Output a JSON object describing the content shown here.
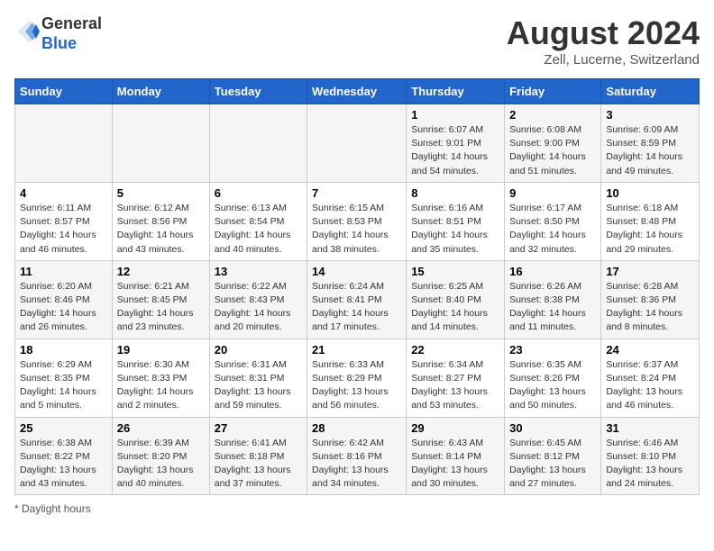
{
  "header": {
    "logo_line1": "General",
    "logo_line2": "Blue",
    "month_year": "August 2024",
    "location": "Zell, Lucerne, Switzerland"
  },
  "footer": {
    "note": "Daylight hours"
  },
  "days_of_week": [
    "Sunday",
    "Monday",
    "Tuesday",
    "Wednesday",
    "Thursday",
    "Friday",
    "Saturday"
  ],
  "weeks": [
    [
      {
        "day": "",
        "info": ""
      },
      {
        "day": "",
        "info": ""
      },
      {
        "day": "",
        "info": ""
      },
      {
        "day": "",
        "info": ""
      },
      {
        "day": "1",
        "info": "Sunrise: 6:07 AM\nSunset: 9:01 PM\nDaylight: 14 hours\nand 54 minutes."
      },
      {
        "day": "2",
        "info": "Sunrise: 6:08 AM\nSunset: 9:00 PM\nDaylight: 14 hours\nand 51 minutes."
      },
      {
        "day": "3",
        "info": "Sunrise: 6:09 AM\nSunset: 8:59 PM\nDaylight: 14 hours\nand 49 minutes."
      }
    ],
    [
      {
        "day": "4",
        "info": "Sunrise: 6:11 AM\nSunset: 8:57 PM\nDaylight: 14 hours\nand 46 minutes."
      },
      {
        "day": "5",
        "info": "Sunrise: 6:12 AM\nSunset: 8:56 PM\nDaylight: 14 hours\nand 43 minutes."
      },
      {
        "day": "6",
        "info": "Sunrise: 6:13 AM\nSunset: 8:54 PM\nDaylight: 14 hours\nand 40 minutes."
      },
      {
        "day": "7",
        "info": "Sunrise: 6:15 AM\nSunset: 8:53 PM\nDaylight: 14 hours\nand 38 minutes."
      },
      {
        "day": "8",
        "info": "Sunrise: 6:16 AM\nSunset: 8:51 PM\nDaylight: 14 hours\nand 35 minutes."
      },
      {
        "day": "9",
        "info": "Sunrise: 6:17 AM\nSunset: 8:50 PM\nDaylight: 14 hours\nand 32 minutes."
      },
      {
        "day": "10",
        "info": "Sunrise: 6:18 AM\nSunset: 8:48 PM\nDaylight: 14 hours\nand 29 minutes."
      }
    ],
    [
      {
        "day": "11",
        "info": "Sunrise: 6:20 AM\nSunset: 8:46 PM\nDaylight: 14 hours\nand 26 minutes."
      },
      {
        "day": "12",
        "info": "Sunrise: 6:21 AM\nSunset: 8:45 PM\nDaylight: 14 hours\nand 23 minutes."
      },
      {
        "day": "13",
        "info": "Sunrise: 6:22 AM\nSunset: 8:43 PM\nDaylight: 14 hours\nand 20 minutes."
      },
      {
        "day": "14",
        "info": "Sunrise: 6:24 AM\nSunset: 8:41 PM\nDaylight: 14 hours\nand 17 minutes."
      },
      {
        "day": "15",
        "info": "Sunrise: 6:25 AM\nSunset: 8:40 PM\nDaylight: 14 hours\nand 14 minutes."
      },
      {
        "day": "16",
        "info": "Sunrise: 6:26 AM\nSunset: 8:38 PM\nDaylight: 14 hours\nand 11 minutes."
      },
      {
        "day": "17",
        "info": "Sunrise: 6:28 AM\nSunset: 8:36 PM\nDaylight: 14 hours\nand 8 minutes."
      }
    ],
    [
      {
        "day": "18",
        "info": "Sunrise: 6:29 AM\nSunset: 8:35 PM\nDaylight: 14 hours\nand 5 minutes."
      },
      {
        "day": "19",
        "info": "Sunrise: 6:30 AM\nSunset: 8:33 PM\nDaylight: 14 hours\nand 2 minutes."
      },
      {
        "day": "20",
        "info": "Sunrise: 6:31 AM\nSunset: 8:31 PM\nDaylight: 13 hours\nand 59 minutes."
      },
      {
        "day": "21",
        "info": "Sunrise: 6:33 AM\nSunset: 8:29 PM\nDaylight: 13 hours\nand 56 minutes."
      },
      {
        "day": "22",
        "info": "Sunrise: 6:34 AM\nSunset: 8:27 PM\nDaylight: 13 hours\nand 53 minutes."
      },
      {
        "day": "23",
        "info": "Sunrise: 6:35 AM\nSunset: 8:26 PM\nDaylight: 13 hours\nand 50 minutes."
      },
      {
        "day": "24",
        "info": "Sunrise: 6:37 AM\nSunset: 8:24 PM\nDaylight: 13 hours\nand 46 minutes."
      }
    ],
    [
      {
        "day": "25",
        "info": "Sunrise: 6:38 AM\nSunset: 8:22 PM\nDaylight: 13 hours\nand 43 minutes."
      },
      {
        "day": "26",
        "info": "Sunrise: 6:39 AM\nSunset: 8:20 PM\nDaylight: 13 hours\nand 40 minutes."
      },
      {
        "day": "27",
        "info": "Sunrise: 6:41 AM\nSunset: 8:18 PM\nDaylight: 13 hours\nand 37 minutes."
      },
      {
        "day": "28",
        "info": "Sunrise: 6:42 AM\nSunset: 8:16 PM\nDaylight: 13 hours\nand 34 minutes."
      },
      {
        "day": "29",
        "info": "Sunrise: 6:43 AM\nSunset: 8:14 PM\nDaylight: 13 hours\nand 30 minutes."
      },
      {
        "day": "30",
        "info": "Sunrise: 6:45 AM\nSunset: 8:12 PM\nDaylight: 13 hours\nand 27 minutes."
      },
      {
        "day": "31",
        "info": "Sunrise: 6:46 AM\nSunset: 8:10 PM\nDaylight: 13 hours\nand 24 minutes."
      }
    ]
  ]
}
